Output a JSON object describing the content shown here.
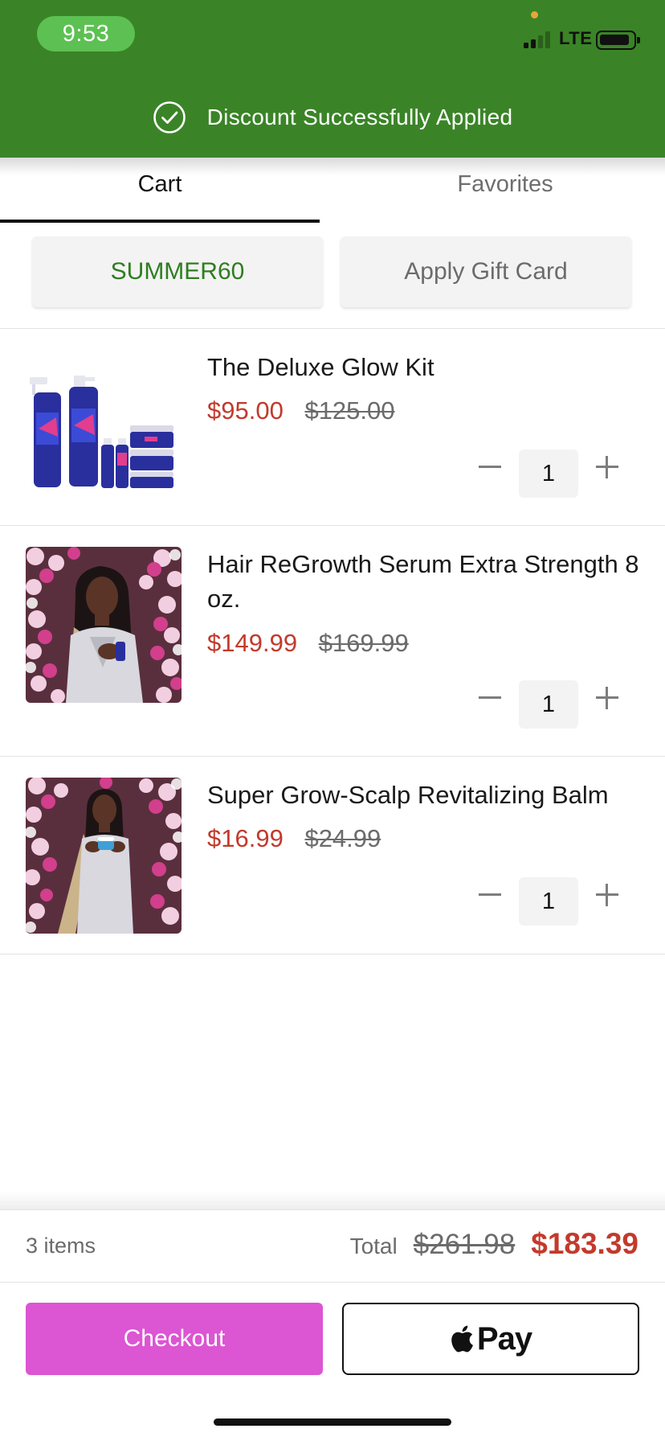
{
  "status_bar": {
    "time": "9:53",
    "network": "LTE",
    "signal_bars": 2,
    "signal_bars_total": 4
  },
  "toast": {
    "message": "Discount Successfully Applied",
    "icon": "check-circle-icon",
    "background_color": "#3a8427"
  },
  "tabs": [
    {
      "label": "Cart",
      "active": true
    },
    {
      "label": "Favorites",
      "active": false
    }
  ],
  "promo": {
    "code": "SUMMER60",
    "gift_card_label": "Apply Gift Card"
  },
  "cart_items": [
    {
      "title": "The Deluxe Glow Kit",
      "price": "$95.00",
      "original_price": "$125.00",
      "quantity": "1",
      "image": "deluxe-glow-kit-product-photo"
    },
    {
      "title": "Hair ReGrowth Serum Extra Strength 8 oz.",
      "price": "$149.99",
      "original_price": "$169.99",
      "quantity": "1",
      "image": "model-holding-serum-photo"
    },
    {
      "title": "Super Grow-Scalp Revitalizing Balm",
      "price": "$16.99",
      "original_price": "$24.99",
      "quantity": "1",
      "image": "model-holding-balm-photo"
    }
  ],
  "summary": {
    "items_count": "3 items",
    "total_label": "Total",
    "total_original": "$261.98",
    "total_discounted": "$183.39"
  },
  "actions": {
    "checkout_label": "Checkout",
    "apple_pay_label": "Pay",
    "checkout_color": "#dc55d3"
  },
  "colors": {
    "sale_price": "#c23a2c",
    "promo_code": "#2f7d20"
  }
}
